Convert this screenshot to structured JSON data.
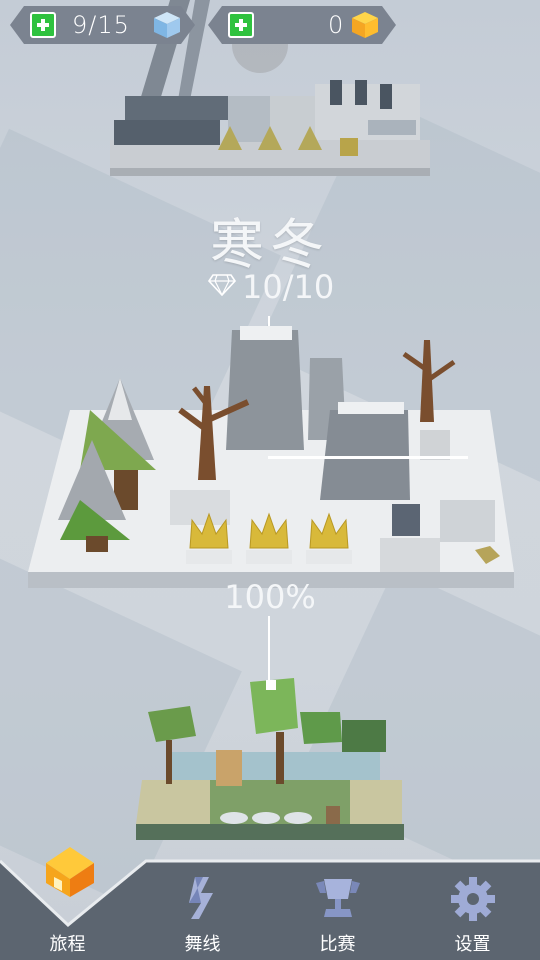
{
  "hud": {
    "cubes_text": "9/15",
    "gems_text": "0"
  },
  "level": {
    "title": "寒冬",
    "gems": "10/10",
    "progress": "100%"
  },
  "nav": {
    "items": [
      {
        "label": "旅程",
        "icon": "house-icon"
      },
      {
        "label": "舞线",
        "icon": "dance-line-icon"
      },
      {
        "label": "比赛",
        "icon": "trophy-icon"
      },
      {
        "label": "设置",
        "icon": "gear-icon"
      }
    ]
  },
  "colors": {
    "hud_bg": "#7b8390",
    "plus_green": "#2fc23f",
    "nav_bg": "#5a636e",
    "house_orange": "#f39a1c"
  }
}
